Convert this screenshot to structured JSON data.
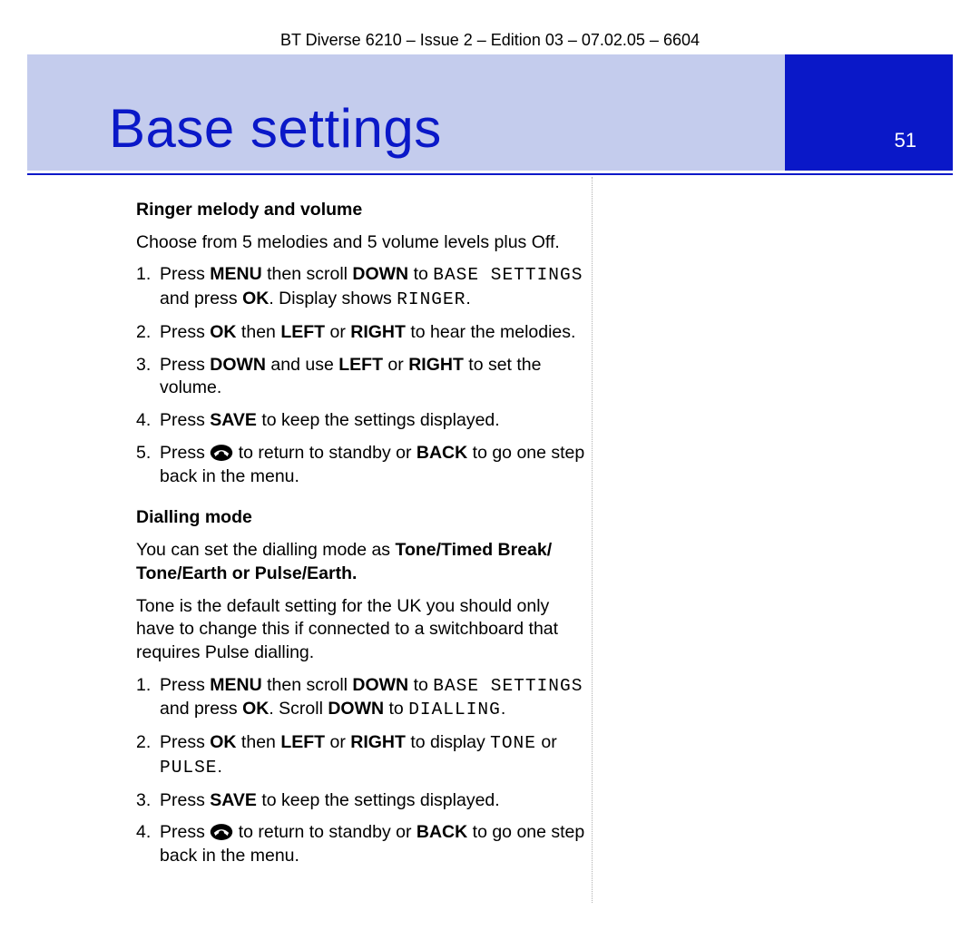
{
  "header": "BT Diverse 6210 – Issue 2 – Edition 03 – 07.02.05 – 6604",
  "banner": {
    "title": "Base settings",
    "page": "51"
  },
  "s1": {
    "heading": "Ringer melody and volume",
    "intro": "Choose from 5 melodies and 5 volume levels plus Off.",
    "step1": {
      "a": "Press ",
      "b": "MENU",
      "c": " then scroll ",
      "d": "DOWN",
      "e": " to ",
      "lcd": "BASE SETTINGS",
      "f": " and press ",
      "g": "OK",
      "h": ". Display shows ",
      "lcd2": "RINGER",
      "i": "."
    },
    "step2": {
      "a": "Press ",
      "b": "OK",
      "c": " then ",
      "d": "LEFT",
      "e": " or ",
      "f": "RIGHT",
      "g": " to hear the melodies."
    },
    "step3": {
      "a": "Press ",
      "b": "DOWN",
      "c": " and use ",
      "d": "LEFT",
      "e": " or ",
      "f": "RIGHT",
      "g": " to set the volume."
    },
    "step4": {
      "a": "Press ",
      "b": "SAVE",
      "c": " to keep the settings displayed."
    },
    "step5": {
      "a": "Press ",
      "b": " to return to standby or ",
      "c": "BACK",
      "d": " to go one step back in the menu."
    }
  },
  "s2": {
    "heading": "Dialling mode",
    "intro": {
      "a": "You can set the dialling mode as ",
      "b": "Tone/Timed Break/ Tone/Earth or Pulse/Earth."
    },
    "note": "Tone is the default setting for the UK you should only have to change this if connected to a switchboard that requires Pulse dialling.",
    "step1": {
      "a": "Press ",
      "b": "MENU",
      "c": " then scroll ",
      "d": "DOWN",
      "e": " to ",
      "lcd": "BASE SETTINGS",
      "f": " and press ",
      "g": "OK",
      "h": ". Scroll ",
      "i": "DOWN",
      "j": " to ",
      "lcd2": "DIALLING",
      "k": "."
    },
    "step2": {
      "a": "Press ",
      "b": "OK",
      "c": " then ",
      "d": "LEFT",
      "e": " or ",
      "f": "RIGHT",
      "g": " to display ",
      "lcd": "TONE",
      "h": " or ",
      "lcd2": "PULSE",
      "i": "."
    },
    "step3": {
      "a": "Press ",
      "b": "SAVE",
      "c": " to keep the settings displayed."
    },
    "step4": {
      "a": "Press ",
      "b": " to return to standby or ",
      "c": "BACK",
      "d": " to go one step back in the menu."
    }
  }
}
